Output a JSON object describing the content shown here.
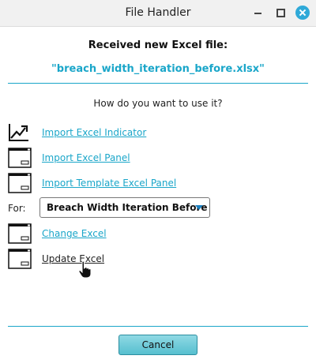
{
  "window": {
    "title": "File Handler"
  },
  "dialog": {
    "heading": "Received new Excel file:",
    "filename": "\"breach_width_iteration_before.xlsx\"",
    "question": "How do you want to use it?"
  },
  "options": [
    {
      "label": "Import Excel Indicator",
      "icon": "chart-trend-icon"
    },
    {
      "label": "Import Excel Panel",
      "icon": "window-panel-icon"
    },
    {
      "label": "Import Template Excel Panel",
      "icon": "window-panel-icon"
    },
    {
      "label": "Change Excel",
      "icon": "window-panel-icon"
    },
    {
      "label": "Update Excel",
      "icon": "window-panel-icon"
    }
  ],
  "for_selector": {
    "label": "For:",
    "selected": "Breach Width Iteration Before"
  },
  "buttons": {
    "cancel": "Cancel"
  },
  "colors": {
    "accent": "#1aa6c9",
    "close_button": "#2fa9d8",
    "cancel_button": "#6ccad8"
  }
}
